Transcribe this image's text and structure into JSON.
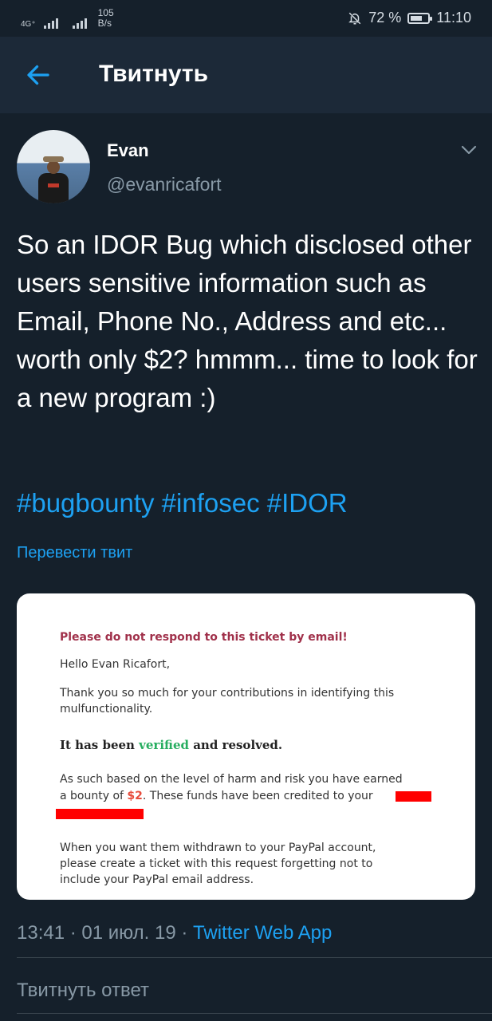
{
  "status_bar": {
    "network_type": "4G⁺",
    "net_speed_value": "105",
    "net_speed_unit": "B/s",
    "battery_percent": "72 %",
    "battery_level": 0.72,
    "time": "11:10",
    "icons": [
      "signal-icon",
      "signal-icon",
      "bell-off-icon",
      "battery-icon"
    ]
  },
  "header": {
    "title": "Твитнуть",
    "back_icon": "arrow-left-icon"
  },
  "tweet": {
    "author_name": "Evan",
    "author_handle": "@evanricafort",
    "text": "So an IDOR Bug which disclosed other users sensitive information such as Email, Phone No., Address and etc... worth only $2? hmmm... time to look for a new program :)",
    "hashtags": [
      "#bugbounty",
      "#infosec",
      "#IDOR"
    ],
    "translate_label": "Перевести твит",
    "time": "13:41",
    "date": "01 июл. 19",
    "separator": "·",
    "source": "Twitter Web App"
  },
  "image_card": {
    "warning": "Please do not respond to this ticket by email!",
    "greeting": "Hello Evan Ricafort,",
    "thanks": "Thank you so much for your contributions in identifying this mulfunctionality.",
    "verified_prefix": "It has been ",
    "verified_word": "verified",
    "verified_suffix": " and resolved.",
    "bounty_line_1": "As such based on the level of harm and risk you have earned",
    "bounty_prefix": "a bounty of ",
    "bounty_amount": "$2",
    "bounty_suffix": ". These funds have been credited to your",
    "withdraw": "When you want them withdrawn to your PayPal account, please create a ticket with this request forgetting not to include your PayPal email address."
  },
  "reply": {
    "placeholder": "Твитнуть ответ"
  },
  "colors": {
    "background": "#15202b",
    "header": "#1c2938",
    "accent": "#1da1f2",
    "secondary_text": "#8899a6"
  }
}
